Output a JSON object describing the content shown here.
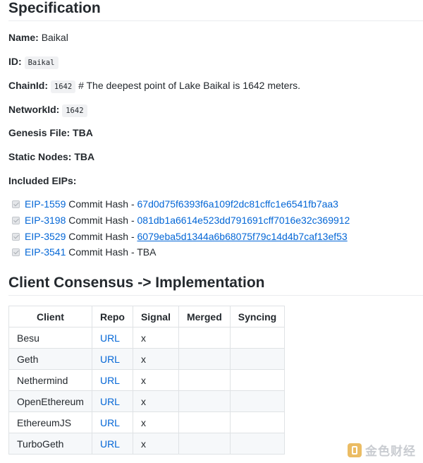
{
  "spec": {
    "heading": "Specification",
    "name_label": "Name:",
    "name_value": "Baikal",
    "id_label": "ID:",
    "id_value": "Baikal",
    "chainid_label": "ChainId:",
    "chainid_value": "1642",
    "chainid_comment": "# The deepest point of Lake Baikal is 1642 meters.",
    "networkid_label": "NetworkId:",
    "networkid_value": "1642",
    "genesis_label": "Genesis File:",
    "genesis_value": "TBA",
    "static_label": "Static Nodes:",
    "static_value": "TBA",
    "eips_label": "Included EIPs:",
    "eips": [
      {
        "eip": "EIP-1559",
        "text": "Commit Hash -",
        "hash": "67d0d75f6393f6a109f2dc81cffc1e6541fb7aa3"
      },
      {
        "eip": "EIP-3198",
        "text": "Commit Hash -",
        "hash": "081db1a6614e523dd791691cff7016e32c369912"
      },
      {
        "eip": "EIP-3529",
        "text": "Commit Hash -",
        "hash": "6079eba5d1344a6b68075f79c14d4b7caf13ef53"
      },
      {
        "eip": "EIP-3541",
        "text": "Commit Hash - TBA"
      }
    ]
  },
  "consensus": {
    "heading": "Client Consensus -> Implementation",
    "headers": [
      "Client",
      "Repo",
      "Signal",
      "Merged",
      "Syncing"
    ],
    "rows": [
      {
        "client": "Besu",
        "repo": "URL",
        "signal": "x",
        "merged": "",
        "syncing": ""
      },
      {
        "client": "Geth",
        "repo": "URL",
        "signal": "x",
        "merged": "",
        "syncing": ""
      },
      {
        "client": "Nethermind",
        "repo": "URL",
        "signal": "x",
        "merged": "",
        "syncing": ""
      },
      {
        "client": "OpenEthereum",
        "repo": "URL",
        "signal": "x",
        "merged": "",
        "syncing": ""
      },
      {
        "client": "EthereumJS",
        "repo": "URL",
        "signal": "x",
        "merged": "",
        "syncing": ""
      },
      {
        "client": "TurboGeth",
        "repo": "URL",
        "signal": "x",
        "merged": "",
        "syncing": ""
      }
    ]
  },
  "watermark": {
    "text": "金色财经",
    "icon": "jinse-logo-icon"
  }
}
